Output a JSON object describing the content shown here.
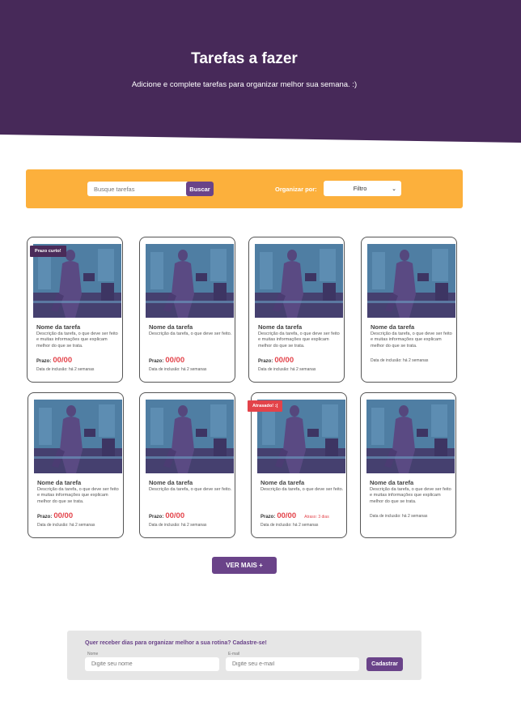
{
  "hero": {
    "title": "Tarefas a fazer",
    "subtitle": "Adicione e complete tarefas para organizar melhor sua semana. :)",
    "bg_color": "#472959"
  },
  "toolbar": {
    "search_placeholder": "Busque tarefas",
    "search_button": "Buscar",
    "sort_label": "Organizar por:",
    "filter_value": "Filtro",
    "bg_color": "#fcb03c"
  },
  "deadline_label": "Prazo:",
  "tasks": [
    {
      "badge": "Prazo curto!",
      "badge_type": "short",
      "name": "Nome da tarefa",
      "description": "Descrição da tarefa, o que deve ser feito e muitas informações que explicam melhor do que se trata.",
      "deadline": "00/00",
      "late_note": "",
      "added": "Data de inclusão: há 2 semanas"
    },
    {
      "badge": "",
      "badge_type": "",
      "name": "Nome da tarefa",
      "description": "Descrição da tarefa, o que deve ser feito.",
      "deadline": "00/00",
      "late_note": "",
      "added": "Data de inclusão: há 2 semanas"
    },
    {
      "badge": "",
      "badge_type": "",
      "name": "Nome da tarefa",
      "description": "Descrição da tarefa, o que deve ser feito e muitas informações que explicam melhor do que se trata.",
      "deadline": "00/00",
      "late_note": "",
      "added": "Data de inclusão: há 2 semanas"
    },
    {
      "badge": "",
      "badge_type": "",
      "name": "Nome da tarefa",
      "description": "Descrição da tarefa, o que deve ser feito e muitas informações que explicam melhor do que se trata.",
      "deadline": "",
      "late_note": "",
      "added": "Data de inclusão: há 2 semanas"
    },
    {
      "badge": "",
      "badge_type": "",
      "name": "Nome da tarefa",
      "description": "Descrição da tarefa, o que deve ser feito e muitas informações que explicam melhor do que se trata.",
      "deadline": "00/00",
      "late_note": "",
      "added": "Data de inclusão: há 2 semanas"
    },
    {
      "badge": "",
      "badge_type": "",
      "name": "Nome da tarefa",
      "description": "Descrição da tarefa, o que deve ser feito.",
      "deadline": "00/00",
      "late_note": "",
      "added": "Data de inclusão: há 2 semanas"
    },
    {
      "badge": "Atrasado! :(",
      "badge_type": "late",
      "name": "Nome da tarefa",
      "description": "Descrição da tarefa, o que deve ser feito.",
      "deadline": "00/00",
      "late_note": "Atraso: 3 dias",
      "added": "Data de inclusão: há 2 semanas"
    },
    {
      "badge": "",
      "badge_type": "",
      "name": "Nome da tarefa",
      "description": "Descrição da tarefa, o que deve ser feito e muitas informações que explicam melhor do que se trata.",
      "deadline": "",
      "late_note": "",
      "added": "Data de inclusão: há 2 semanas"
    }
  ],
  "more_button": "VER MAIS +",
  "newsletter": {
    "title": "Quer receber dias para organizar melhor a sua rotina? Cadastre-se!",
    "name_label": "Nome",
    "name_placeholder": "Digite seu nome",
    "email_label": "E-mail",
    "email_placeholder": "Digite seu e-mail",
    "submit": "Cadastrar"
  },
  "colors": {
    "accent": "#6a4389",
    "danger": "#e3434a",
    "short_badge": "#4a2b59"
  },
  "icons": [
    "chevron-down-icon"
  ]
}
